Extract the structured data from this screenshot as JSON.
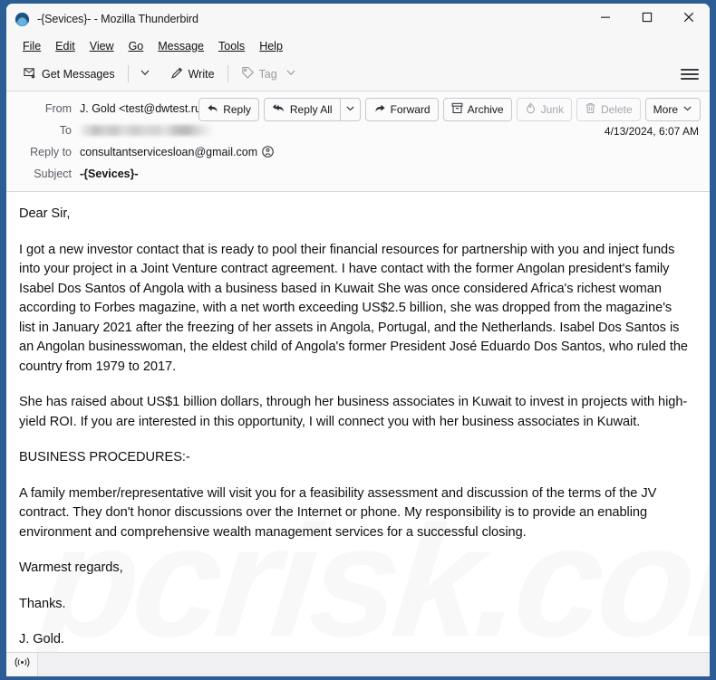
{
  "window": {
    "title": "-{Sevices}- - Mozilla Thunderbird",
    "logo_icon": "thunderbird-logo-icon",
    "controls": {
      "minimize": "minimize-icon",
      "maximize": "maximize-icon",
      "close": "close-icon"
    }
  },
  "menubar": {
    "items": [
      {
        "label": "File"
      },
      {
        "label": "Edit"
      },
      {
        "label": "View"
      },
      {
        "label": "Go"
      },
      {
        "label": "Message"
      },
      {
        "label": "Tools"
      },
      {
        "label": "Help"
      }
    ]
  },
  "toolbar": {
    "get_messages_label": "Get Messages",
    "get_messages_icon": "get-messages-envelope-icon",
    "get_messages_chevron": "chevron-down-icon",
    "write_label": "Write",
    "write_icon": "pencil-icon",
    "tag_label": "Tag",
    "tag_icon": "tag-icon",
    "tag_chevron": "chevron-down-icon",
    "app_menu_icon": "hamburger-menu-icon"
  },
  "message_header": {
    "rows": [
      {
        "label": "From",
        "value": "J. Gold <test@dwtest.ru>",
        "has_contact_icon": true,
        "bold": false
      },
      {
        "label": "To",
        "value": "",
        "redacted": true,
        "has_contact_icon": false,
        "bold": false
      },
      {
        "label": "Reply to",
        "value": "consultantservicesloan@gmail.com",
        "has_contact_icon": true,
        "bold": false
      },
      {
        "label": "Subject",
        "value": "-{Sevices}-",
        "has_contact_icon": false,
        "bold": true
      }
    ],
    "date": "4/13/2024, 6:07 AM",
    "actions": {
      "reply": "Reply",
      "reply_all": "Reply All",
      "reply_all_chevron": "chevron-down-icon",
      "forward": "Forward",
      "archive": "Archive",
      "junk": "Junk",
      "delete": "Delete",
      "more": "More",
      "more_chevron": "chevron-down-icon",
      "reply_icon": "reply-arrow-icon",
      "reply_all_icon": "reply-all-arrow-icon",
      "forward_icon": "forward-arrow-icon",
      "archive_icon": "archive-box-icon",
      "junk_icon": "junk-flame-icon",
      "delete_icon": "trash-icon"
    }
  },
  "message_body": {
    "watermark": "pcrisk.com",
    "paragraphs": [
      "Dear Sir,",
      "I got a new investor contact that is ready to pool their financial resources for partnership with you and inject funds into your project in a Joint Venture contract agreement. I have contact with the former Angolan president's family Isabel Dos Santos of Angola with a business based in Kuwait She was once considered Africa's richest woman according to Forbes magazine, with a net worth exceeding US$2.5 billion, she was dropped from the magazine's list in January 2021 after the freezing of her assets in Angola, Portugal, and the Netherlands. Isabel Dos Santos is an Angolan businesswoman, the eldest child of Angola's former President José Eduardo Dos Santos, who ruled the country from 1979 to 2017.",
      "She has raised about US$1 billion dollars, through her business associates in Kuwait to invest in projects with high-yield ROI. If you are interested in this opportunity, I will connect you with her business associates in Kuwait.",
      "BUSINESS PROCEDURES:-",
      "A family member/representative will visit you for a feasibility assessment and discussion of the terms of the JV contract. They don't honor discussions over the Internet or phone. My responsibility is to provide an enabling environment and comprehensive wealth management services for a successful closing.",
      "Warmest regards,",
      "Thanks.",
      "J. Gold."
    ]
  },
  "statusbar": {
    "connection_icon": "online-status-icon",
    "text": ""
  }
}
